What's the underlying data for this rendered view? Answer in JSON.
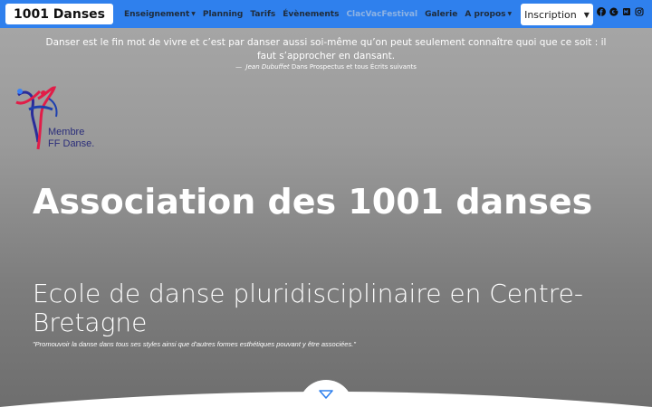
{
  "navbar": {
    "brand": "1001 Danses",
    "items": [
      {
        "label": "Enseignement",
        "dropdown": true
      },
      {
        "label": "Planning",
        "dropdown": false
      },
      {
        "label": "Tarifs",
        "dropdown": false
      },
      {
        "label": "Évènements",
        "dropdown": false
      },
      {
        "label": "ClacVacFestival",
        "dropdown": false
      },
      {
        "label": "Galerie",
        "dropdown": false
      },
      {
        "label": "A propos",
        "dropdown": true
      }
    ],
    "inscription_label": "Inscription",
    "socials": [
      "facebook-icon",
      "google-icon",
      "meetup-icon",
      "instagram-icon"
    ],
    "color": "#2f80ed"
  },
  "quote": {
    "text": "Danser est le fin mot de vivre et c’est par danser aussi soi-même qu’on peut seulement connaître quoi que ce soit : il faut s’approcher en dansant.",
    "dash": "—",
    "author": "Jean Dubuffet",
    "source": "Dans Prospectus et tous Écrits suivants"
  },
  "logo": {
    "line1": "Membre",
    "line2": "FF Danse."
  },
  "hero": {
    "title": "Association des 1001 danses",
    "subtitle": "Ecole de danse pluridisciplinaire en Centre-Bretagne",
    "motto": "\"Promouvoir la danse dans tous ses styles ainsi que d'autres formes esthétiques pouvant y être associées.\""
  }
}
